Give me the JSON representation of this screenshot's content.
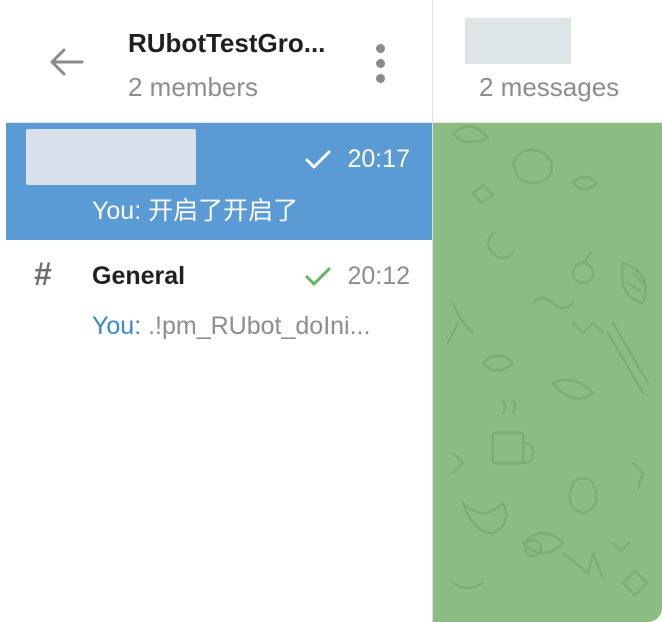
{
  "header": {
    "title": "RUbotTestGro...",
    "subtitle": "2 members"
  },
  "chats": [
    {
      "time": "20:17",
      "message": "You: 开启了开启了"
    },
    {
      "name": "General",
      "time": "20:12",
      "sender": "You:",
      "message": ".!pm_RUbot_doIni..."
    }
  ],
  "right_header": {
    "count": "2 messages"
  },
  "colors": {
    "selected_bg": "#5a9bd6",
    "chat_bg": "#8cbc82",
    "check_green": "#5cb85c",
    "link_blue": "#3a88cc"
  },
  "icons": {
    "back": "arrow-left-icon",
    "menu": "more-vertical-icon",
    "channel": "hash-icon",
    "read": "check-icon"
  }
}
